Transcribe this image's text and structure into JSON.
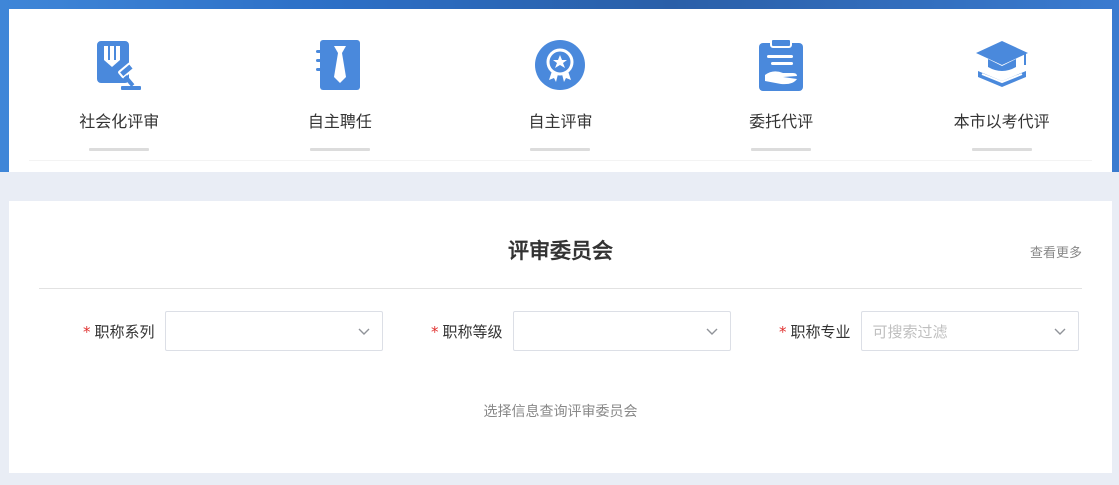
{
  "nav": {
    "items": [
      {
        "label": "社会化评审",
        "icon": "gavel-icon"
      },
      {
        "label": "自主聘任",
        "icon": "tie-icon"
      },
      {
        "label": "自主评审",
        "icon": "award-badge-icon"
      },
      {
        "label": "委托代评",
        "icon": "clipboard-hand-icon"
      },
      {
        "label": "本市以考代评",
        "icon": "graduation-cap-icon"
      }
    ]
  },
  "committee": {
    "title": "评审委员会",
    "view_more": "查看更多",
    "filters": [
      {
        "label": "职称系列",
        "required": "*",
        "value": "",
        "placeholder": ""
      },
      {
        "label": "职称等级",
        "required": "*",
        "value": "",
        "placeholder": ""
      },
      {
        "label": "职称专业",
        "required": "*",
        "value": "",
        "placeholder": "可搜索过滤"
      }
    ],
    "hint": "选择信息查询评审委员会"
  },
  "colors": {
    "accent": "#4a89dc",
    "required": "#e0312f"
  }
}
